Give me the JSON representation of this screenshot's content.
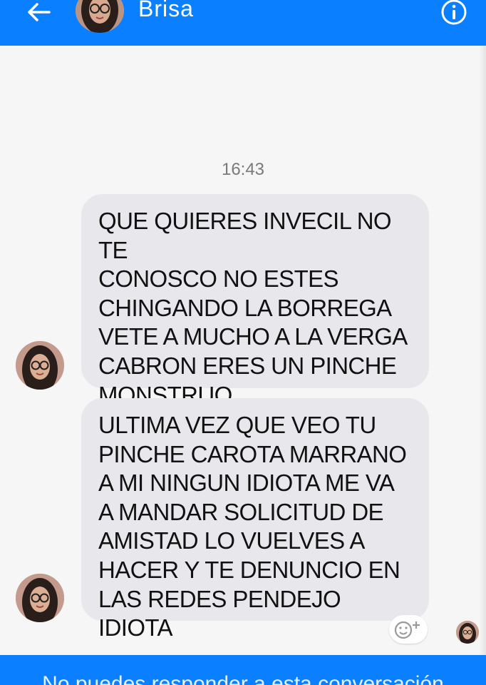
{
  "header": {
    "contact_name": "Brisa",
    "back_icon": "arrow-left-icon",
    "info_icon": "info-icon",
    "color": "#0a7fff"
  },
  "conversation": {
    "timestamp": "16:43",
    "messages": [
      {
        "text": "QUE QUIERES INVECIL NO TE\nCONOSCO NO ESTES\nCHINGANDO LA BORREGA\nVETE A MUCHO A LA VERGA\nCABRON ERES UN PINCHE\nMONSTRUO"
      },
      {
        "text": "ULTIMA VEZ QUE VEO TU\nPINCHE CAROTA MARRANO\nA MI NINGUN IDIOTA ME VA\nA MANDAR SOLICITUD DE\nAMISTAD LO VUELVES A\nHACER Y TE DENUNCIO EN\nLAS REDES PENDEJO IDIOTA"
      }
    ],
    "bubble_color": "#e8e8ec",
    "reaction_icon": "add-reaction-icon"
  },
  "footer": {
    "text": "No puedes responder a esta conversación",
    "color": "#0a7fff"
  }
}
